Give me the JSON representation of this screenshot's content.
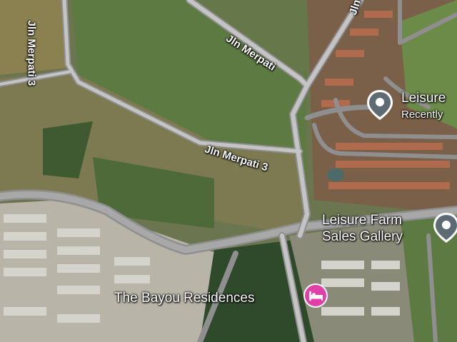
{
  "roads": {
    "merpati_3_vertical": "Jln Merpati 3",
    "merpati_top": "Jln Merpati",
    "merpati_top_right": "Jln",
    "merpati_3_middle": "Jln Merpati 3"
  },
  "places": {
    "leisure_top": {
      "name": "Leisure",
      "subtitle": "Recently",
      "icon": "location-pin-icon",
      "color": "#5f6b73"
    },
    "sales_gallery": {
      "name_line1": "Leisure Farm",
      "name_line2": "Sales Gallery",
      "icon": "location-pin-icon",
      "color": "#5f6b73"
    },
    "bayou": {
      "name": "The Bayou Residences",
      "icon": "hotel-bed-icon",
      "color": "#e040a8"
    }
  }
}
